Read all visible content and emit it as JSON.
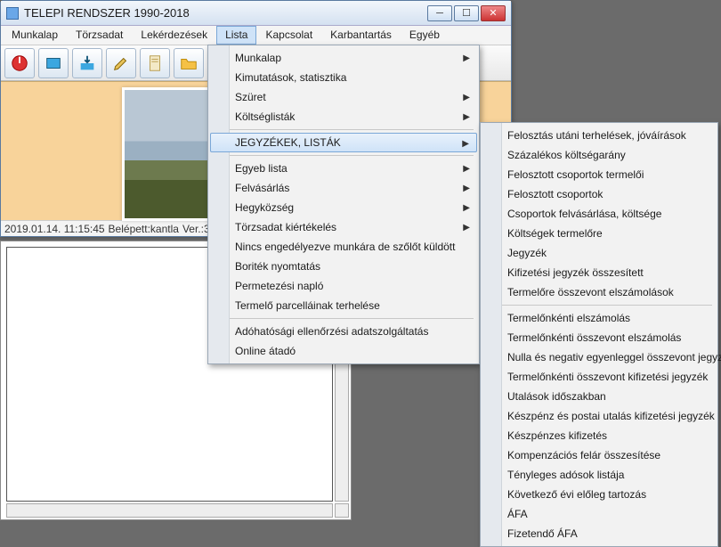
{
  "window": {
    "title": "TELEPI RENDSZER  1990-2018"
  },
  "menubar": [
    "Munkalap",
    "Törzsadat",
    "Lekérdezések",
    "Lista",
    "Kapcsolat",
    "Karbantartás",
    "Egyéb"
  ],
  "menubar_active_index": 3,
  "status": {
    "datetime": "2019.01.14. 11:15:45",
    "user": "Belépett:kantla",
    "ver": "Ver.:3"
  },
  "dropdown1": {
    "groups": [
      [
        {
          "label": "Munkalap",
          "sub": true
        },
        {
          "label": "Kimutatások, statisztika"
        },
        {
          "label": "Szüret",
          "sub": true
        },
        {
          "label": "Költséglisták",
          "sub": true
        }
      ],
      [
        {
          "label": "JEGYZÉKEK, LISTÁK",
          "sub": true,
          "hl": true
        }
      ],
      [
        {
          "label": "Egyeb lista",
          "sub": true
        },
        {
          "label": "Felvásárlás",
          "sub": true
        },
        {
          "label": "Hegyközség",
          "sub": true
        },
        {
          "label": "Törzsadat kiértékelés",
          "sub": true
        },
        {
          "label": "Nincs engedélyezve munkára de szőlőt küldött"
        },
        {
          "label": "Boriték nyomtatás"
        },
        {
          "label": "Permetezési napló"
        },
        {
          "label": "Termelő parcelláinak terhelése"
        }
      ],
      [
        {
          "label": "Adóhatósági ellenőrzési adatszolgáltatás"
        },
        {
          "label": "Online átadó"
        }
      ]
    ]
  },
  "dropdown2": {
    "groups": [
      [
        {
          "label": "Felosztás utáni terhelések, jóváírások"
        },
        {
          "label": "Százalékos költségarány"
        },
        {
          "label": "Felosztott csoportok termelői"
        },
        {
          "label": "Felosztott csoportok"
        },
        {
          "label": "Csoportok felvásárlása, költsége"
        },
        {
          "label": "Költségek termelőre"
        },
        {
          "label": "Jegyzék"
        },
        {
          "label": "Kifizetési jegyzék összesített"
        },
        {
          "label": "Termelőre összevont elszámolások"
        }
      ],
      [
        {
          "label": "Termelőnkénti elszámolás"
        },
        {
          "label": "Termelőnkénti összevont elszámolás"
        },
        {
          "label": "Nulla és negativ egyenleggel összevont jegyzék"
        },
        {
          "label": "Termelőnkénti összevont kifizetési jegyzék"
        },
        {
          "label": "Utalások időszakban"
        },
        {
          "label": "Készpénz és postai utalás kifizetési jegyzék"
        },
        {
          "label": "Készpénzes kifizetés"
        },
        {
          "label": "Kompenzációs felár összesítése"
        },
        {
          "label": "Tényleges adósok listája"
        },
        {
          "label": "Következő évi előleg tartozás"
        },
        {
          "label": "ÁFA"
        },
        {
          "label": "Fizetendő ÁFA"
        }
      ]
    ]
  }
}
